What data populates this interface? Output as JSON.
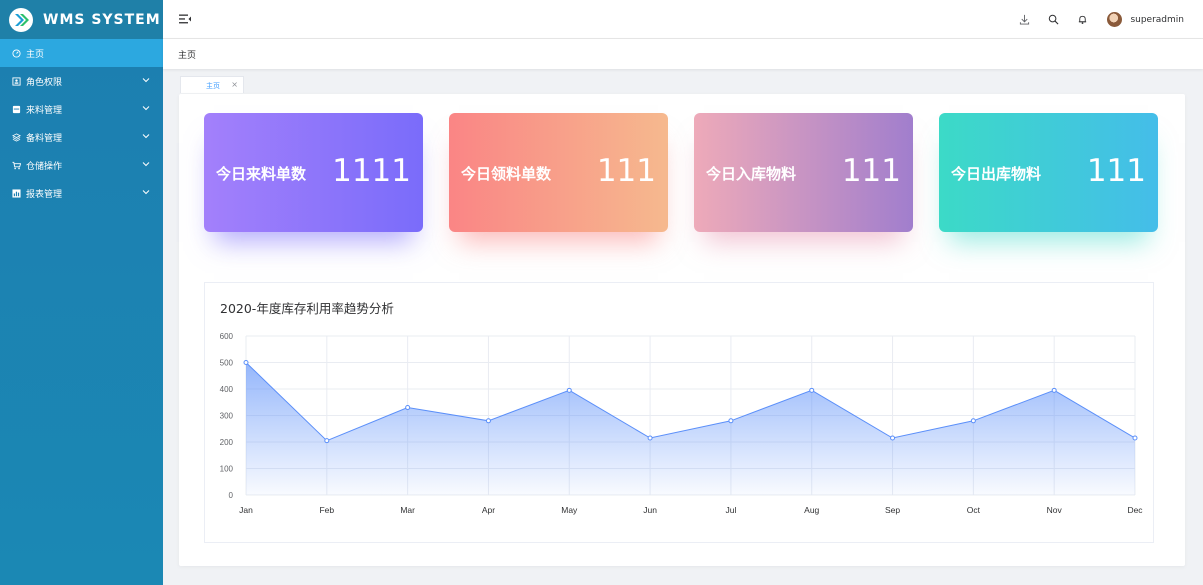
{
  "app": {
    "title": "WMS SYSTEM"
  },
  "sidebar": {
    "items": [
      {
        "label": "主页",
        "icon": "dashboard-icon",
        "active": true
      },
      {
        "label": "角色权限",
        "icon": "user-card-icon",
        "active": false
      },
      {
        "label": "来料管理",
        "icon": "box-icon",
        "active": false
      },
      {
        "label": "备料管理",
        "icon": "layers-icon",
        "active": false
      },
      {
        "label": "仓储操作",
        "icon": "cart-icon",
        "active": false
      },
      {
        "label": "报表管理",
        "icon": "report-icon",
        "active": false
      }
    ]
  },
  "header": {
    "icons": [
      "download-icon",
      "search-icon",
      "bell-icon"
    ],
    "username": "superadmin"
  },
  "breadcrumb": {
    "current": "主页"
  },
  "tabs": [
    {
      "label": "主页",
      "close": "×"
    }
  ],
  "cards": [
    {
      "label": "今日来料单数",
      "value": "1111"
    },
    {
      "label": "今日领料单数",
      "value": "111"
    },
    {
      "label": "今日入库物料",
      "value": "111"
    },
    {
      "label": "今日出库物料",
      "value": "111"
    }
  ],
  "colors": {
    "sidebar": "#1c7eb0",
    "active_menu": "#2ca8e0",
    "line": "#5b8ff9",
    "accent": "#409eff"
  },
  "chart_data": {
    "type": "area",
    "title": "2020-年度库存利用率趋势分析",
    "categories": [
      "Jan",
      "Feb",
      "Mar",
      "Apr",
      "May",
      "Jun",
      "Jul",
      "Aug",
      "Sep",
      "Oct",
      "Nov",
      "Dec"
    ],
    "values": [
      500,
      205,
      330,
      280,
      395,
      215,
      280,
      395,
      215,
      280,
      395,
      215
    ],
    "ylim": [
      0,
      600
    ],
    "yticks": [
      0,
      100,
      200,
      300,
      400,
      500,
      600
    ],
    "grid": true,
    "xlabel": "",
    "ylabel": ""
  }
}
